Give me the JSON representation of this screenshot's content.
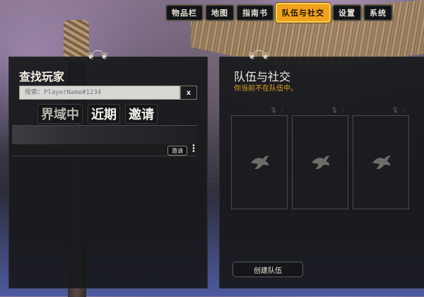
{
  "nav": {
    "tabs": [
      {
        "label": "物品栏",
        "active": false
      },
      {
        "label": "地图",
        "active": false
      },
      {
        "label": "指南书",
        "active": false
      },
      {
        "label": "队伍与社交",
        "active": true
      },
      {
        "label": "设置",
        "active": false
      },
      {
        "label": "系统",
        "active": false
      }
    ]
  },
  "find_player": {
    "title": "查找玩家",
    "search_placeholder": "搜索：PlayerName#1234",
    "clear_label": "x",
    "tabs": [
      {
        "label": "界域中",
        "active": false
      },
      {
        "label": "近期",
        "active": true
      },
      {
        "label": "邀请",
        "active": true
      }
    ],
    "result": {
      "invite_label": "邀请"
    }
  },
  "team": {
    "title": "队伍与社交",
    "status": "你当前不在队伍中。",
    "slots": [
      {
        "icons": [
          "mic-icon",
          "more-icon"
        ]
      },
      {
        "icons": [
          "mic-icon",
          "more-icon"
        ]
      },
      {
        "icons": [
          "mic-icon",
          "more-icon"
        ]
      }
    ],
    "create_label": "创建队伍"
  },
  "colors": {
    "accent": "#f0a21b",
    "status_text": "#e3a21d",
    "panel_bg": "#18191c"
  }
}
